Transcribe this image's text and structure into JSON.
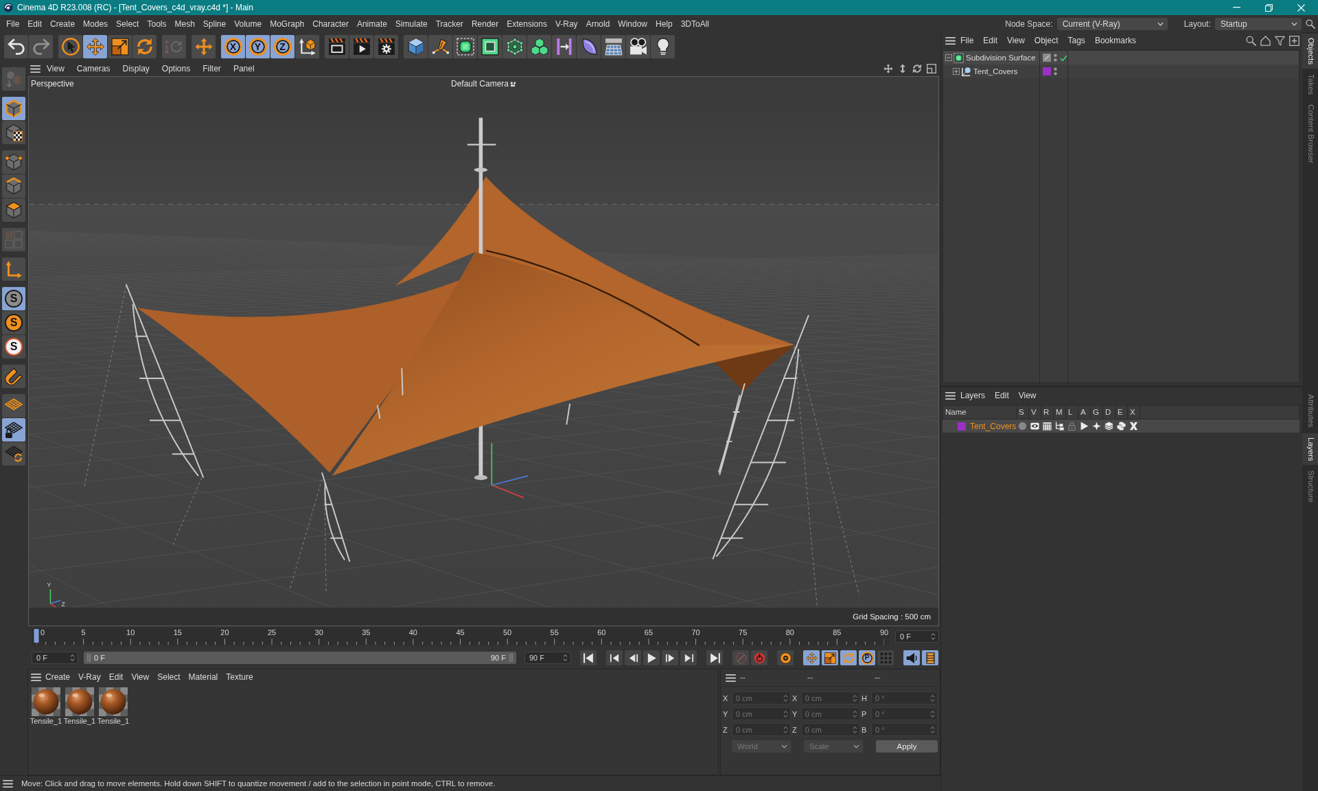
{
  "window": {
    "title": "Cinema 4D R23.008 (RC) - [Tent_Covers_c4d_vray.c4d *] - Main"
  },
  "menu_bar": {
    "items": [
      "File",
      "Edit",
      "Create",
      "Modes",
      "Select",
      "Tools",
      "Mesh",
      "Spline",
      "Volume",
      "MoGraph",
      "Character",
      "Animate",
      "Simulate",
      "Tracker",
      "Render",
      "Extensions",
      "V-Ray",
      "Arnold",
      "Window",
      "Help",
      "3DToAll"
    ],
    "node_space": {
      "label": "Node Space:",
      "value": "Current (V-Ray)"
    },
    "layout": {
      "label": "Layout:",
      "value": "Startup"
    }
  },
  "toolbar": {
    "groups": [
      [
        {
          "kind": "undo",
          "on": false,
          "disabled": false
        },
        {
          "kind": "redo",
          "on": false,
          "disabled": true
        }
      ],
      [
        {
          "kind": "select",
          "on": false,
          "disabled": false
        },
        {
          "kind": "move",
          "on": true,
          "disabled": false
        },
        {
          "kind": "scale",
          "on": false,
          "disabled": false
        },
        {
          "kind": "rotate",
          "on": false,
          "disabled": false
        }
      ],
      [
        {
          "kind": "psr",
          "label": "PSR",
          "on": false,
          "disabled": true
        }
      ],
      [
        {
          "kind": "recent-tool",
          "on": false,
          "disabled": false
        }
      ],
      [
        {
          "kind": "axis-lock",
          "label": "X",
          "on": true,
          "disabled": false
        },
        {
          "kind": "axis-lock",
          "label": "Y",
          "on": true,
          "disabled": false
        },
        {
          "kind": "axis-lock",
          "label": "Z",
          "on": true,
          "disabled": false
        },
        {
          "kind": "coordinate-system",
          "on": false,
          "disabled": false
        }
      ],
      [
        {
          "kind": "render-view",
          "on": false,
          "disabled": false
        },
        {
          "kind": "render",
          "on": false,
          "disabled": false
        },
        {
          "kind": "render-settings",
          "on": false,
          "disabled": false
        }
      ],
      [
        {
          "kind": "cube",
          "on": false,
          "disabled": false
        },
        {
          "kind": "pen",
          "on": false,
          "disabled": false
        },
        {
          "kind": "subdivision",
          "on": false,
          "disabled": false
        },
        {
          "kind": "extrude",
          "on": false,
          "disabled": false
        },
        {
          "kind": "cloner",
          "on": false,
          "disabled": false
        },
        {
          "kind": "cubes",
          "on": false,
          "disabled": false
        },
        {
          "kind": "deformer",
          "on": false,
          "disabled": false
        },
        {
          "kind": "field",
          "on": false,
          "disabled": false
        },
        {
          "kind": "floor",
          "on": false,
          "disabled": false
        },
        {
          "kind": "camera",
          "on": false,
          "disabled": false
        },
        {
          "kind": "light",
          "on": false,
          "disabled": false
        }
      ]
    ]
  },
  "left_toolbar": {
    "groups": [
      [
        {
          "kind": "convert",
          "on": false,
          "disabled": true
        }
      ],
      [
        {
          "kind": "model",
          "on": true,
          "disabled": false
        },
        {
          "kind": "texture",
          "on": false,
          "disabled": false
        }
      ],
      [
        {
          "kind": "point",
          "on": false,
          "disabled": false
        },
        {
          "kind": "edge",
          "on": false,
          "disabled": false
        },
        {
          "kind": "polygon",
          "on": false,
          "disabled": false
        }
      ],
      [
        {
          "kind": "uv",
          "on": false,
          "disabled": true
        }
      ],
      [
        {
          "kind": "axis",
          "on": false,
          "disabled": false
        }
      ],
      [
        {
          "kind": "snap",
          "label": "S",
          "on": true,
          "disabled": false
        },
        {
          "kind": "snap-settings",
          "label": "S",
          "on": false,
          "disabled": false
        },
        {
          "kind": "snap-quantize",
          "label": "S",
          "on": false,
          "disabled": false
        }
      ],
      [
        {
          "kind": "tweak",
          "on": false,
          "disabled": false
        }
      ],
      [
        {
          "kind": "workplane",
          "on": false,
          "disabled": false
        },
        {
          "kind": "workplane-lock",
          "on": true,
          "disabled": false
        },
        {
          "kind": "workplane-align",
          "on": false,
          "disabled": false
        }
      ]
    ]
  },
  "viewport": {
    "menu": [
      "View",
      "Cameras",
      "Display",
      "Options",
      "Filter",
      "Panel"
    ],
    "view_name": "Perspective",
    "camera": "Default Camera",
    "axis_labels": [
      "Y",
      "Z"
    ],
    "grid_spacing": "Grid Spacing : 500 cm"
  },
  "timeline": {
    "ticks": [
      "0",
      "5",
      "10",
      "15",
      "20",
      "25",
      "30",
      "35",
      "40",
      "45",
      "50",
      "55",
      "60",
      "65",
      "70",
      "75",
      "80",
      "85",
      "90"
    ],
    "playhead": {
      "level": 0
    },
    "current_frame": "0 F"
  },
  "transport": {
    "start_field": "0 F",
    "range": {
      "start": "0 F",
      "end": "90 F"
    },
    "end_field": "90 F",
    "groups": [
      [
        {
          "kind": "go-start",
          "on": false,
          "disabled": false
        }
      ],
      [
        {
          "kind": "prev-key",
          "on": false,
          "disabled": false
        },
        {
          "kind": "prev-frame",
          "on": false,
          "disabled": false
        },
        {
          "kind": "play",
          "on": false,
          "disabled": false
        },
        {
          "kind": "next-frame",
          "on": false,
          "disabled": false
        },
        {
          "kind": "next-key",
          "on": false,
          "disabled": false
        }
      ],
      [
        {
          "kind": "go-end",
          "on": false,
          "disabled": false
        }
      ],
      [
        {
          "kind": "record",
          "on": false,
          "disabled": true
        },
        {
          "kind": "auto-key",
          "on": false,
          "disabled": false
        }
      ],
      [
        {
          "kind": "key-selection",
          "on": false,
          "disabled": false
        }
      ],
      [
        {
          "kind": "key-position",
          "on": true,
          "disabled": false
        },
        {
          "kind": "key-scale",
          "on": true,
          "disabled": false
        },
        {
          "kind": "key-rotation",
          "on": true,
          "disabled": false
        },
        {
          "kind": "key-param",
          "label": "P",
          "on": true,
          "disabled": false
        },
        {
          "kind": "key-points",
          "on": false,
          "disabled": false
        }
      ],
      [
        {
          "kind": "sound",
          "on": true,
          "disabled": false
        },
        {
          "kind": "film",
          "on": true,
          "disabled": false
        }
      ]
    ]
  },
  "material_manager": {
    "menu": [
      "Create",
      "V-Ray",
      "Edit",
      "View",
      "Select",
      "Material",
      "Texture"
    ],
    "materials": [
      {
        "name": "Tensile_1"
      },
      {
        "name": "Tensile_1"
      },
      {
        "name": "Tensile_1"
      }
    ]
  },
  "coordinates": {
    "headers": [
      "--",
      "--",
      "--"
    ],
    "disabled": true,
    "columns": [
      [
        {
          "label": "X",
          "value": "0 cm"
        },
        {
          "label": "Y",
          "value": "0 cm"
        },
        {
          "label": "Z",
          "value": "0 cm"
        }
      ],
      [
        {
          "label": "X",
          "value": "0 cm"
        },
        {
          "label": "Y",
          "value": "0 cm"
        },
        {
          "label": "Z",
          "value": "0 cm"
        }
      ],
      [
        {
          "label": "H",
          "value": "0 °"
        },
        {
          "label": "P",
          "value": "0 °"
        },
        {
          "label": "B",
          "value": "0 °"
        }
      ]
    ],
    "dropdowns": [
      "World",
      "Scale"
    ],
    "apply": "Apply"
  },
  "status_bar": {
    "text": "Move: Click and drag to move elements. Hold down SHIFT to quantize movement / add to the selection in point mode, CTRL to remove."
  },
  "objects_manager": {
    "menu": [
      "File",
      "Edit",
      "View",
      "Object",
      "Tags",
      "Bookmarks"
    ],
    "objects": [
      {
        "name": "Subdivision Surface",
        "kind": "subdivision",
        "expanded": true,
        "generator_enabled": true,
        "children": [
          {
            "name": "Tent_Covers",
            "kind": "polygon",
            "expanded": false,
            "generator_enabled": false,
            "color": "#9b30c6"
          }
        ]
      }
    ]
  },
  "layers_manager": {
    "menu": [
      "Layers",
      "Edit",
      "View"
    ],
    "columns": [
      "Name",
      "S",
      "V",
      "R",
      "M",
      "L",
      "A",
      "G",
      "D",
      "E",
      "X"
    ],
    "layers": [
      {
        "name": "Tent_Covers",
        "color": "#9b30c6",
        "toggles": [
          {
            "kind": "solo",
            "on": false
          },
          {
            "kind": "view",
            "on": true
          },
          {
            "kind": "render",
            "on": true
          },
          {
            "kind": "manager",
            "on": true
          },
          {
            "kind": "lock",
            "on": false
          },
          {
            "kind": "animation",
            "on": true
          },
          {
            "kind": "generators",
            "on": true
          },
          {
            "kind": "deformers",
            "on": true
          },
          {
            "kind": "expressions",
            "on": true
          },
          {
            "kind": "xrefs",
            "on": true
          }
        ]
      }
    ]
  },
  "side_tabs": {
    "top": [
      {
        "label": "Objects",
        "selected": true
      },
      {
        "label": "Takes",
        "selected": false
      },
      {
        "label": "Content Browser",
        "selected": false
      }
    ],
    "bottom": [
      {
        "label": "Attributes",
        "selected": false
      },
      {
        "label": "Layers",
        "selected": true
      },
      {
        "label": "Structure",
        "selected": false
      }
    ]
  }
}
